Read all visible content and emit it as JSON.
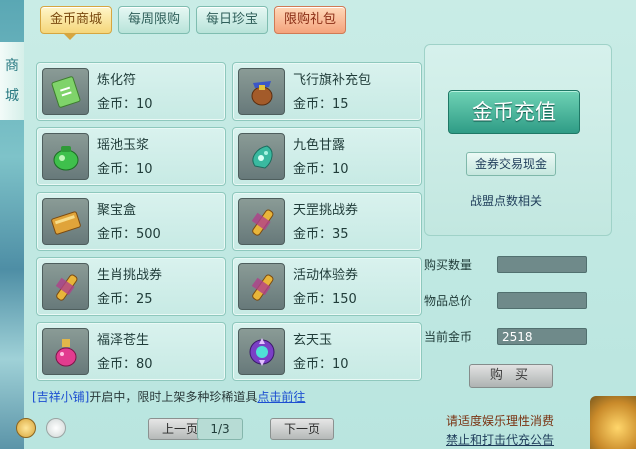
{
  "sidebar": {
    "label_top": "商",
    "label_bottom": "城"
  },
  "tabs": [
    {
      "label": "金币商城",
      "active": true
    },
    {
      "label": "每周限购"
    },
    {
      "label": "每日珍宝"
    },
    {
      "label": "限购礼包"
    }
  ],
  "items": [
    {
      "name": "炼化符",
      "price": "金币：10",
      "icon": "talisman-icon"
    },
    {
      "name": "飞行旗补充包",
      "price": "金币：15",
      "icon": "pouch-icon"
    },
    {
      "name": "瑶池玉浆",
      "price": "金币：10",
      "icon": "jade-jar-icon"
    },
    {
      "name": "九色甘露",
      "price": "金币：10",
      "icon": "dew-gourd-icon"
    },
    {
      "name": "聚宝盒",
      "price": "金币：500",
      "icon": "treasure-box-icon"
    },
    {
      "name": "天罡挑战券",
      "price": "金币：35",
      "icon": "scroll-icon"
    },
    {
      "name": "生肖挑战券",
      "price": "金币：25",
      "icon": "scroll-icon"
    },
    {
      "name": "活动体验券",
      "price": "金币：150",
      "icon": "scroll-icon"
    },
    {
      "name": "福泽苍生",
      "price": "金币：80",
      "icon": "potion-icon"
    },
    {
      "name": "玄天玉",
      "price": "金币：10",
      "icon": "purple-gem-icon"
    }
  ],
  "right": {
    "recharge_label": "金币充值",
    "coupon_label": "金券交易现金",
    "league_label": "战盟点数相关"
  },
  "form": {
    "qty_label": "购买数量",
    "total_label": "物品总价",
    "current_label": "当前金币",
    "qty_value": "",
    "total_value": "",
    "current_value": "2518",
    "buy_label": "购 买"
  },
  "notice": {
    "shop": "[吉祥小铺]",
    "text": "开启中，限时上架多种珍稀道具",
    "link": "点击前往"
  },
  "pager": {
    "prev": "上一页",
    "page": "1/3",
    "next": "下一页"
  },
  "warnings": {
    "line1": "请适度娱乐理性消费",
    "line2": "禁止和打击代充公告"
  }
}
